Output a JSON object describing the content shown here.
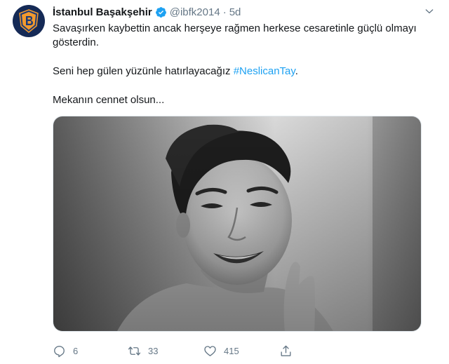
{
  "tweet": {
    "author": {
      "display_name": "İstanbul Başakşehir",
      "handle": "@ibfk2014",
      "verified_icon": "verified-badge-icon",
      "avatar_icon": "club-crest-icon",
      "avatar_color": "#152a56"
    },
    "separator": "·",
    "time": "5d",
    "menu_icon": "chevron-down-icon",
    "text": {
      "line1": "Savaşırken kaybettin ancak herşeye rağmen herkese cesaretinle güçlü olmayı",
      "line2": "gösterdin.",
      "line3_prefix": "Seni hep gülen yüzünle hatırlayacağız ",
      "hashtag": "#NeslicanTay",
      "line3_suffix": ".",
      "line4": "Mekanın cennet olsun..."
    },
    "media": {
      "type": "black-and-white portrait photo"
    },
    "actions": {
      "reply_count": "6",
      "retweet_count": "33",
      "like_count": "415",
      "icons": [
        "reply-icon",
        "retweet-icon",
        "like-icon",
        "share-icon"
      ]
    },
    "colors": {
      "link": "#1da1f2",
      "secondary_text": "#657786",
      "text": "#14171a"
    }
  }
}
